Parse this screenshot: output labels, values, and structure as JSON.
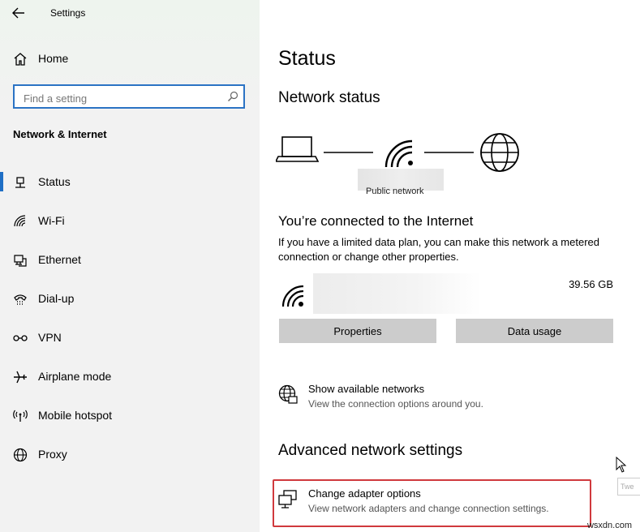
{
  "window": {
    "title": "Settings"
  },
  "sidebar": {
    "home_label": "Home",
    "search_placeholder": "Find a setting",
    "section_title": "Network & Internet",
    "items": [
      {
        "label": "Status",
        "icon": "status-icon",
        "active": true
      },
      {
        "label": "Wi-Fi",
        "icon": "wifi-icon"
      },
      {
        "label": "Ethernet",
        "icon": "ethernet-icon"
      },
      {
        "label": "Dial-up",
        "icon": "dialup-icon"
      },
      {
        "label": "VPN",
        "icon": "vpn-icon"
      },
      {
        "label": "Airplane mode",
        "icon": "airplane-icon"
      },
      {
        "label": "Mobile hotspot",
        "icon": "hotspot-icon"
      },
      {
        "label": "Proxy",
        "icon": "proxy-icon"
      }
    ]
  },
  "main": {
    "page_title": "Status",
    "network_status_heading": "Network status",
    "network_type": "Public network",
    "connected_heading": "You’re connected to the Internet",
    "connected_desc": "If you have a limited data plan, you can make this network a metered connection or change other properties.",
    "data_used": "39.56 GB",
    "properties_button": "Properties",
    "data_usage_button": "Data usage",
    "show_networks_title": "Show available networks",
    "show_networks_desc": "View the connection options around you.",
    "advanced_heading": "Advanced network settings",
    "adapter_title": "Change adapter options",
    "adapter_desc": "View network adapters and change connection settings."
  },
  "tooltip_text": "Twe",
  "watermark": "wsxdn.com",
  "colors": {
    "accent": "#1f6fc5",
    "highlight_border": "#d0393d",
    "button_bg": "#cccccc"
  }
}
